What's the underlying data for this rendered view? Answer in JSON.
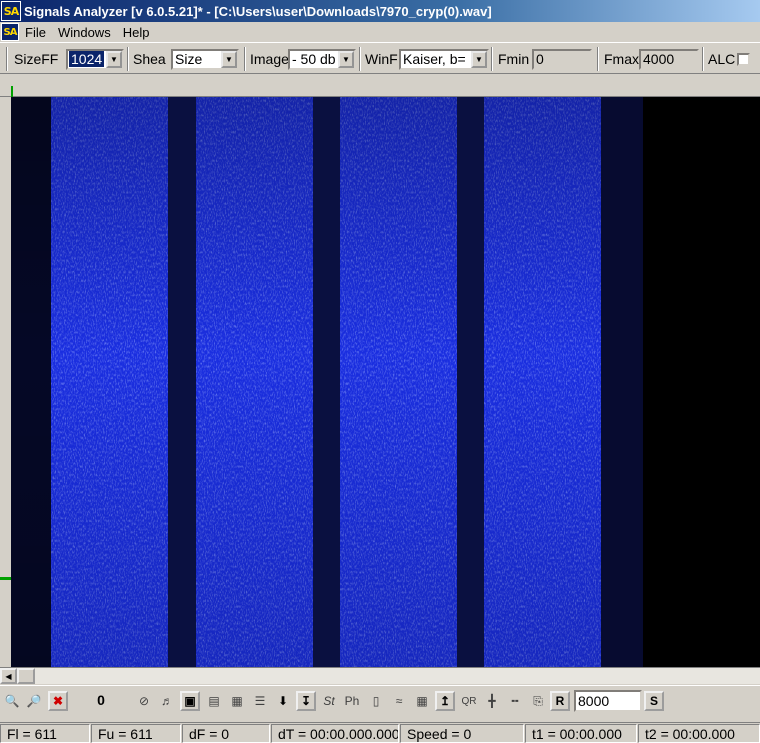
{
  "window": {
    "title": "Signals Analyzer [v 6.0.5.21]* - [C:\\Users\\user\\Downloads\\7970_cryp(0).wav]",
    "logo_text": "SA"
  },
  "menu": {
    "items": [
      "File",
      "Windows",
      "Help"
    ]
  },
  "toolbar": {
    "sizefft_label": "SizeFF",
    "sizefft_value": "1024",
    "sheet_label": "Shea",
    "sheet_value": "Size",
    "image_label": "Image",
    "image_value": "- 50 db",
    "window_label": "WinF",
    "window_value": "Kaiser, b=",
    "fmin_label": "Fmin",
    "fmin_value": "0",
    "fmax_label": "Fmax",
    "fmax_value": "4000",
    "alc_label": "ALC",
    "alc_checked": false
  },
  "bottom_toolbar": {
    "counter_value": "0",
    "r_label": "R",
    "rate_value": "8000",
    "s_label": "S",
    "icons": [
      "zoom-in-icon",
      "zoom-out-icon",
      "close-x-icon",
      "stop-icon",
      "speaker-icon",
      "frame-icon",
      "filter-icon",
      "filter2-icon",
      "equalizer-icon",
      "down-arrow-icon",
      "marker-down-icon",
      "st-icon",
      "ph-icon",
      "bars-icon",
      "wave-icon",
      "comb-icon",
      "arrow-up-icon",
      "qr-icon",
      "split-icon",
      "split2-icon",
      "export-icon"
    ]
  },
  "statusbar": {
    "fl": "Fl = 611",
    "fu": "Fu = 611",
    "df": "dF = 0",
    "dt": "dT = 00:00.000.000",
    "speed": "Speed = 0",
    "t1": "t1 = 00:00.000",
    "t2": "t2 = 00:00.000"
  },
  "colors": {
    "spectrogram_signal": "#1a2ee0",
    "spectrogram_gap": "#0a0f3a",
    "spectrogram_bg": "#000000",
    "marker_green": "#00a000"
  }
}
